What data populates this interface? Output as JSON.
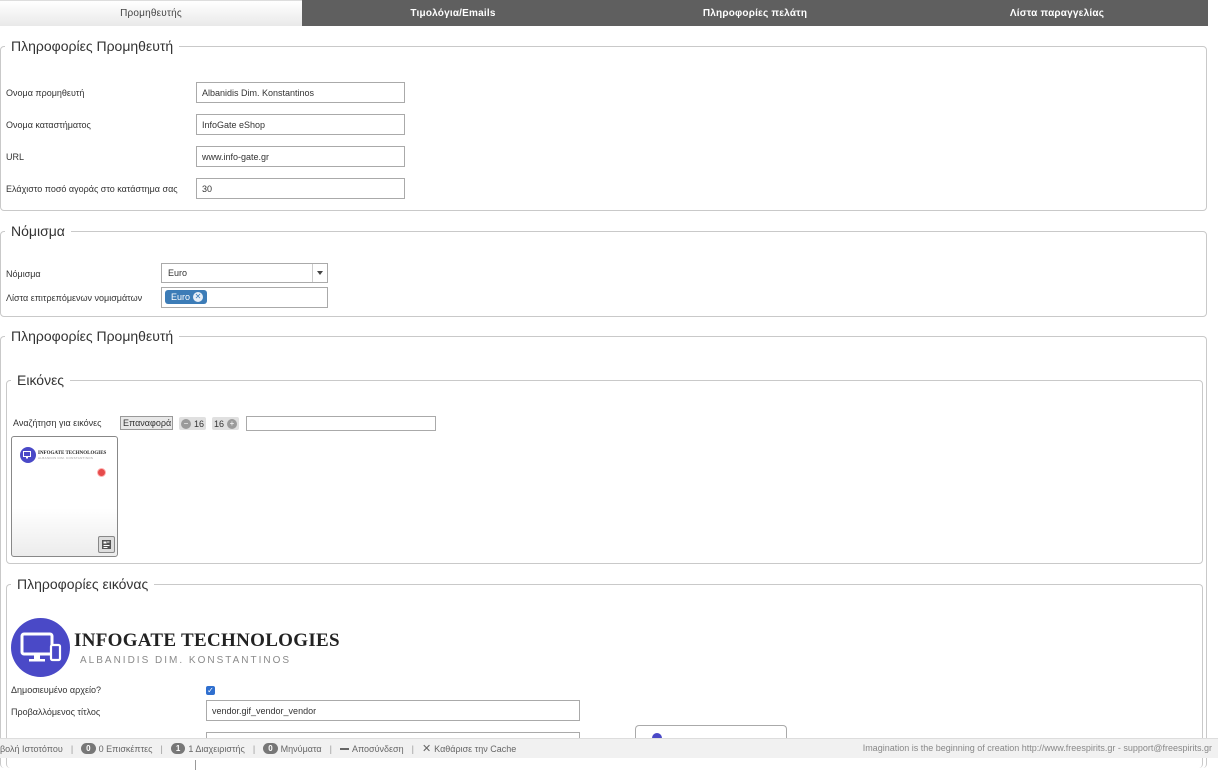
{
  "tabs": [
    {
      "label": "Προμηθευτής",
      "active": true
    },
    {
      "label": "Τιμολόγια/Emails",
      "active": false
    },
    {
      "label": "Πληροφορίες πελάτη",
      "active": false
    },
    {
      "label": "Λίστα παραγγελίας",
      "active": false
    }
  ],
  "vendor_info": {
    "legend": "Πληροφορίες Προμηθευτή",
    "vendor_name_label": "Ονομα προμηθευτή",
    "vendor_name_value": "Albanidis Dim. Konstantinos",
    "store_name_label": "Ονομα καταστήματος",
    "store_name_value": "InfoGate eShop",
    "url_label": "URL",
    "url_value": "www.info-gate.gr",
    "min_amount_label": "Ελάχιστο ποσό αγοράς στο κατάστημα σας",
    "min_amount_value": "30"
  },
  "currency": {
    "legend": "Νόμισμα",
    "currency_label": "Νόμισμα",
    "currency_value": "Euro",
    "allowed_label": "Λίστα επιτρεπόμενων νομισμάτων",
    "allowed_chips": [
      "Euro"
    ]
  },
  "vendor_info2": {
    "legend": "Πληροφορίες Προμηθευτή",
    "images": {
      "legend": "Εικόνες",
      "search_label": "Αναζήτηση για εικόνες",
      "reset_button": "Επαναφορά",
      "pager_left_value": "16",
      "pager_right_value": "16"
    },
    "image_info": {
      "legend": "Πληροφορίες εικόνας",
      "logo_title": "INFOGATE TECHNOLOGIES",
      "logo_subtitle": "ALBANIDIS DIM. KONSTANTINOS",
      "published_label": "Δημοσιευμένο αρχείο?",
      "published_checked": true,
      "display_title_label": "Προβαλλόμενος τίτλος",
      "display_title_value": "vendor.gif_vendor_vendor"
    }
  },
  "statusbar": {
    "view_site": "βολή Ιστοτόπου",
    "visitors_count": "0",
    "visitors_label": "0 Επισκέπτες",
    "admins_count": "1",
    "admins_label": "1 Διαχειριστής",
    "messages_count": "0",
    "messages_label": "Μηνύματα",
    "logout_label": "Αποσύνδεση",
    "cache_label": "Καθάρισε την Cache",
    "right_text": "Imagination is the beginning of creation http://www.freespirits.gr - support@freespirits.gr"
  },
  "colors": {
    "tab_bar": "#5f5f5f",
    "chip": "#3c7cb7",
    "logo": "#4a49c7"
  }
}
